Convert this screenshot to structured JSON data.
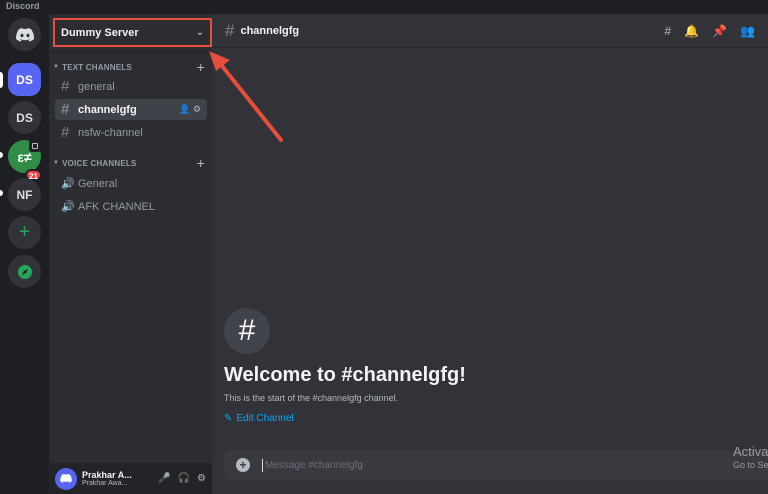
{
  "window": {
    "app_name": "Discord"
  },
  "guilds": {
    "active_label": "DS",
    "second_label": "DS",
    "gfg_label": "ε≠",
    "gfg_badge": "21",
    "nf_label": "NF",
    "add_glyph": "+"
  },
  "server": {
    "name": "Dummy Server"
  },
  "categories": {
    "text": "TEXT CHANNELS",
    "voice": "VOICE CHANNELS"
  },
  "text_channels": [
    {
      "label": "general"
    },
    {
      "label": "channelgfg"
    },
    {
      "label": "nsfw-channel"
    }
  ],
  "voice_channels": [
    {
      "label": "General"
    },
    {
      "label": "AFK CHANNEL"
    }
  ],
  "user": {
    "name": "Prakhar A...",
    "status": "Prakhar Awa..."
  },
  "topbar": {
    "channel": "channelgfg"
  },
  "welcome": {
    "title": "Welcome to #channelgfg!",
    "subtitle": "This is the start of the #channelgfg channel.",
    "edit_label": "Edit Channel"
  },
  "composer": {
    "placeholder": "Message #channelgfg"
  },
  "watermark": {
    "line1": "Activa",
    "line2": "Go to Se"
  },
  "colors": {
    "accent": "#5865f2",
    "annotation": "#e74c3c",
    "link": "#00a8fc"
  }
}
